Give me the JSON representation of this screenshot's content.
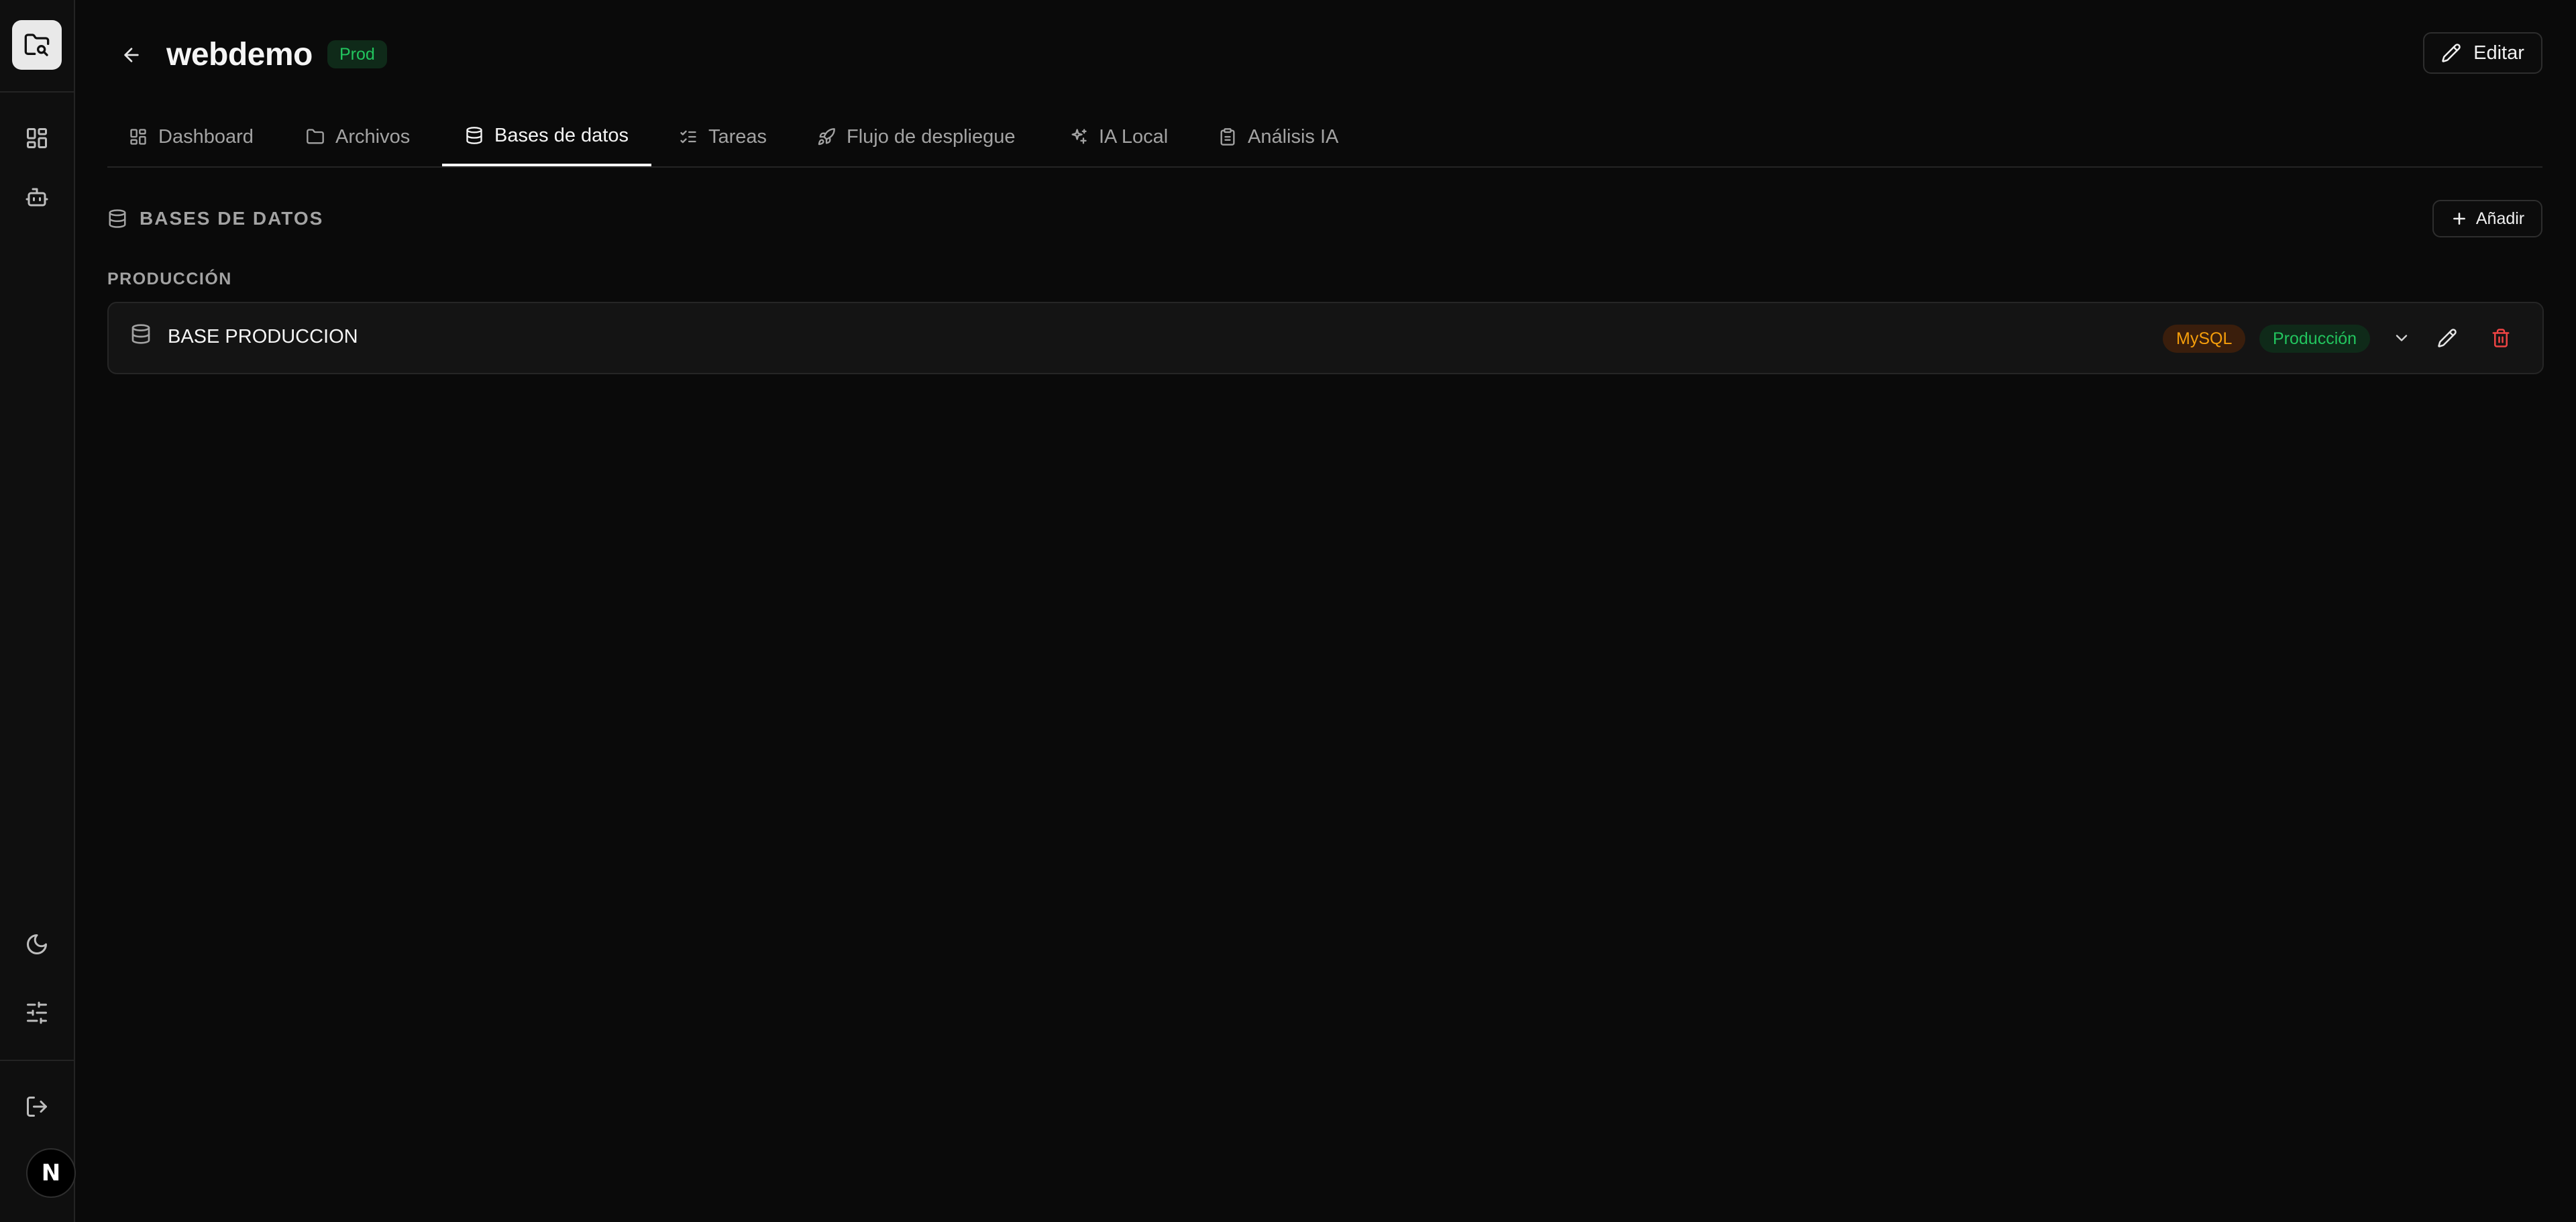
{
  "project": {
    "name": "webdemo",
    "environment_badge": "Prod"
  },
  "header": {
    "edit_label": "Editar"
  },
  "tabs": [
    {
      "label": "Dashboard",
      "icon": "layout-grid-icon"
    },
    {
      "label": "Archivos",
      "icon": "folder-icon"
    },
    {
      "label": "Bases de datos",
      "icon": "database-icon",
      "active": true
    },
    {
      "label": "Tareas",
      "icon": "list-checks-icon"
    },
    {
      "label": "Flujo de despliegue",
      "icon": "rocket-icon"
    },
    {
      "label": "IA Local",
      "icon": "sparkles-icon"
    },
    {
      "label": "Análisis IA",
      "icon": "clipboard-icon"
    }
  ],
  "section": {
    "title": "BASES DE DATOS",
    "add_label": "Añadir"
  },
  "groups": [
    {
      "label": "PRODUCCIÓN",
      "databases": [
        {
          "name": "BASE PRODUCCION",
          "engine": "MySQL",
          "environment": "Producción"
        }
      ]
    }
  ],
  "sidebar": {
    "avatar_letter": "N",
    "icons": [
      "folder-code-icon",
      "layout-grid-icon",
      "bot-icon",
      "moon-icon",
      "sliders-icon",
      "log-out-icon"
    ]
  },
  "colors": {
    "background": "#0a0a0a",
    "success": "#22c55e",
    "warning": "#f59e0b",
    "danger": "#ef4444"
  }
}
